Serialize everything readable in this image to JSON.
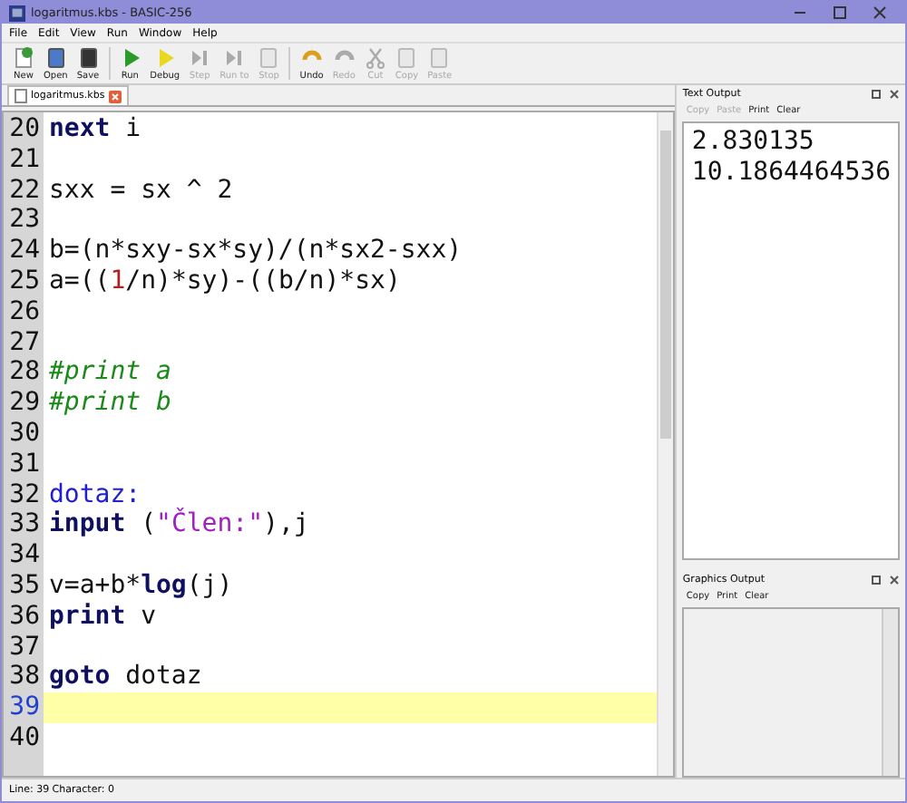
{
  "window": {
    "title": "logaritmus.kbs - BASIC-256"
  },
  "menu": [
    "File",
    "Edit",
    "View",
    "Run",
    "Window",
    "Help"
  ],
  "toolbar": [
    {
      "label": "New",
      "disabled": false
    },
    {
      "label": "Open",
      "disabled": false
    },
    {
      "label": "Save",
      "disabled": false
    },
    {
      "label": "Run",
      "disabled": false
    },
    {
      "label": "Debug",
      "disabled": false
    },
    {
      "label": "Step",
      "disabled": true
    },
    {
      "label": "Run to",
      "disabled": true
    },
    {
      "label": "Stop",
      "disabled": true
    },
    {
      "label": "Undo",
      "disabled": false
    },
    {
      "label": "Redo",
      "disabled": true
    },
    {
      "label": "Cut",
      "disabled": true
    },
    {
      "label": "Copy",
      "disabled": true
    },
    {
      "label": "Paste",
      "disabled": true
    }
  ],
  "tabs": [
    {
      "label": "logaritmus.kbs",
      "selected": true
    }
  ],
  "editor": {
    "lines": [
      {
        "number": "20",
        "current": false,
        "tokens": [
          {
            "kind": "keyword",
            "text": "next"
          },
          {
            "kind": "plain",
            "text": " i"
          }
        ]
      },
      {
        "number": "21",
        "current": false
      },
      {
        "number": "22",
        "current": false,
        "tokens": [
          {
            "kind": "plain",
            "text": "sxx = sx ^ 2"
          }
        ]
      },
      {
        "number": "23",
        "current": false
      },
      {
        "number": "24",
        "current": false,
        "tokens": [
          {
            "kind": "plain",
            "text": "b=(n*sxy-sx*sy)/(n*sx2-sxx)"
          }
        ]
      },
      {
        "number": "25",
        "current": false,
        "tokens": [
          {
            "kind": "plain",
            "text": "a=(("
          },
          {
            "kind": "number",
            "text": "1"
          },
          {
            "kind": "plain",
            "text": "/n)*sy)-((b/n)*sx)"
          }
        ]
      },
      {
        "number": "26",
        "current": false
      },
      {
        "number": "27",
        "current": false
      },
      {
        "number": "28",
        "current": false,
        "tokens": [
          {
            "kind": "comment",
            "text": "#print a"
          }
        ]
      },
      {
        "number": "29",
        "current": false,
        "tokens": [
          {
            "kind": "comment",
            "text": "#print b"
          }
        ]
      },
      {
        "number": "30",
        "current": false
      },
      {
        "number": "31",
        "current": false
      },
      {
        "number": "32",
        "current": false,
        "tokens": [
          {
            "kind": "label",
            "text": "dotaz:"
          }
        ]
      },
      {
        "number": "33",
        "current": false,
        "tokens": [
          {
            "kind": "keyword",
            "text": "input"
          },
          {
            "kind": "plain",
            "text": " ("
          },
          {
            "kind": "string",
            "text": "\"Člen:\""
          },
          {
            "kind": "plain",
            "text": "),j"
          }
        ]
      },
      {
        "number": "34",
        "current": false
      },
      {
        "number": "35",
        "current": false,
        "tokens": [
          {
            "kind": "plain",
            "text": "v=a+b*"
          },
          {
            "kind": "keyword",
            "text": "log"
          },
          {
            "kind": "plain",
            "text": "(j)"
          }
        ]
      },
      {
        "number": "36",
        "current": false,
        "tokens": [
          {
            "kind": "keyword",
            "text": "print"
          },
          {
            "kind": "plain",
            "text": " v"
          }
        ]
      },
      {
        "number": "37",
        "current": false
      },
      {
        "number": "38",
        "current": false,
        "tokens": [
          {
            "kind": "keyword",
            "text": "goto"
          },
          {
            "kind": "plain",
            "text": " dotaz"
          }
        ]
      },
      {
        "number": "39",
        "current": true
      },
      {
        "number": "40",
        "current": false
      }
    ]
  },
  "text_output": {
    "title": "Text Output",
    "buttons": [
      {
        "label": "Copy",
        "disabled": true
      },
      {
        "label": "Paste",
        "disabled": true
      },
      {
        "label": "Print",
        "disabled": false
      },
      {
        "label": "Clear",
        "disabled": false
      }
    ],
    "lines": [
      "2.830135",
      "10.1864464536"
    ]
  },
  "graphics_output": {
    "title": "Graphics Output",
    "buttons": [
      {
        "label": "Copy",
        "disabled": false
      },
      {
        "label": "Print",
        "disabled": false
      },
      {
        "label": "Clear",
        "disabled": false
      }
    ]
  },
  "status_bar": "Line: 39 Character: 0"
}
